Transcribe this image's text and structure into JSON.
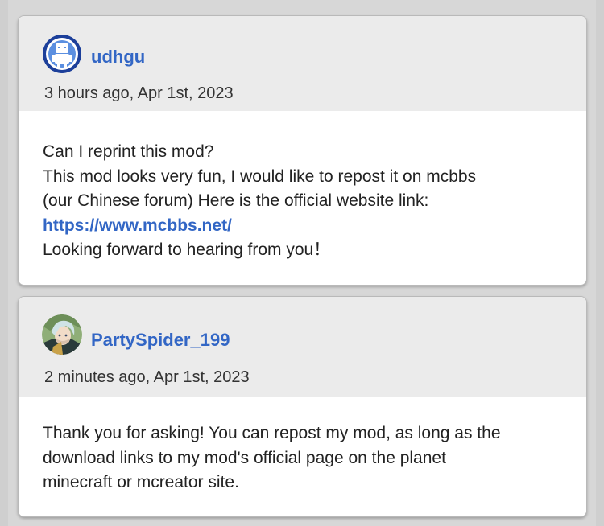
{
  "comments": [
    {
      "username": "udhgu",
      "timestamp": "3 hours ago, Apr 1st, 2023",
      "lines": [
        "Can I reprint this mod?",
        "This mod looks very fun, I would like to repost it on mcbbs",
        "(our Chinese forum) Here is the official website link:"
      ],
      "link": "https://www.mcbbs.net/",
      "closing": "Looking forward to hearing from you！",
      "avatar_icon": "robot-avatar-icon"
    },
    {
      "username": "PartySpider_199",
      "timestamp": "2 minutes ago, Apr 1st, 2023",
      "lines": [
        "Thank you for asking! You can repost my mod, as long as the",
        "download links to my mod's official page on the planet",
        "minecraft or mcreator site."
      ],
      "avatar_icon": "anime-character-avatar-icon"
    }
  ],
  "colors": {
    "accent": "#3266c5",
    "header_bg": "#ebebeb",
    "page_bg": "#cfcfcf"
  }
}
